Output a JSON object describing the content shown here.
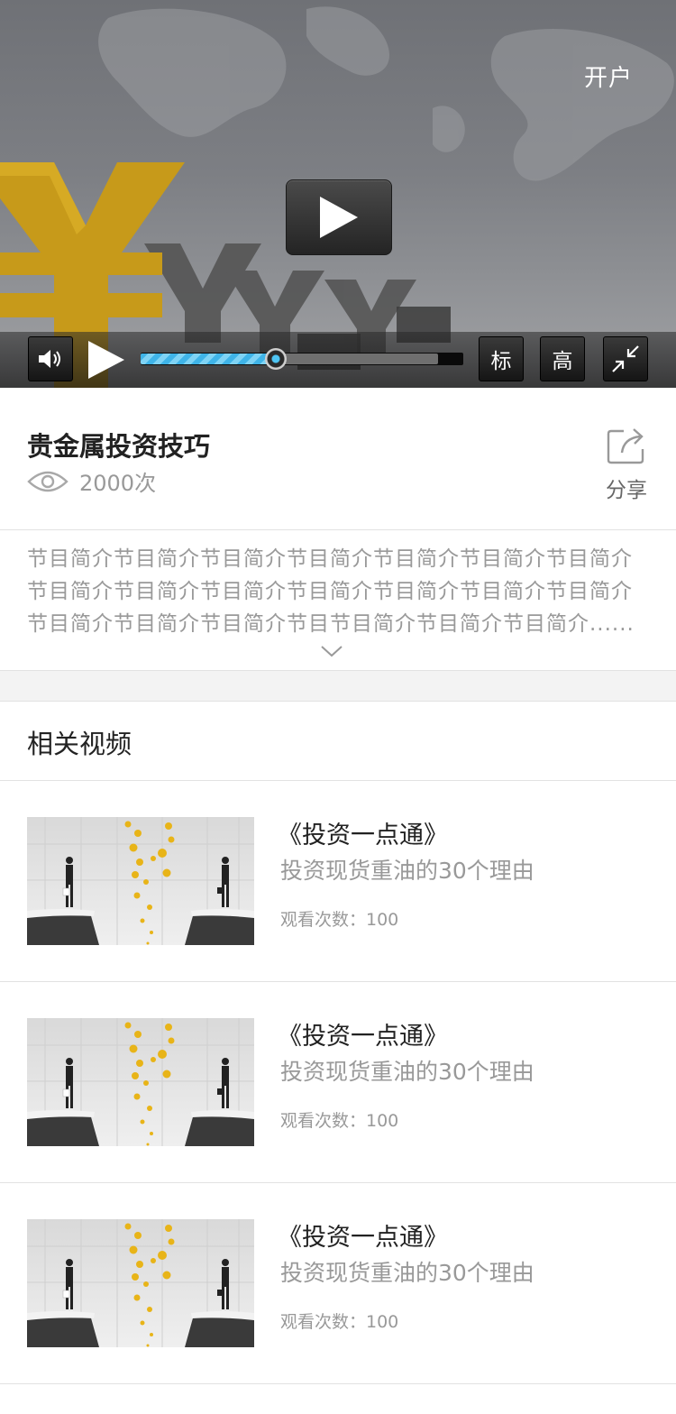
{
  "player": {
    "open_account_label": "开户",
    "progress": 0.42,
    "standard_label": "标",
    "high_label": "高",
    "accent_color": "#3fb4e8"
  },
  "video": {
    "title": "贵金属投资技巧",
    "views": "2000次",
    "share_label": "分享",
    "description": "节目简介节目简介节目简介节目简介节目简介节目简介节目简介节目简介节目简介节目简介节目简介节目简介节目简介节目简介节目简介节目简介节目简介节目节目简介节目简介节目简介......"
  },
  "related": {
    "title": "相关视频",
    "items": [
      {
        "title": "《投资一点通》",
        "subtitle": "投资现货重油的30个理由",
        "views": "观看次数：100"
      },
      {
        "title": "《投资一点通》",
        "subtitle": "投资现货重油的30个理由",
        "views": "观看次数：100"
      },
      {
        "title": "《投资一点通》",
        "subtitle": "投资现货重油的30个理由",
        "views": "观看次数：100"
      }
    ]
  }
}
